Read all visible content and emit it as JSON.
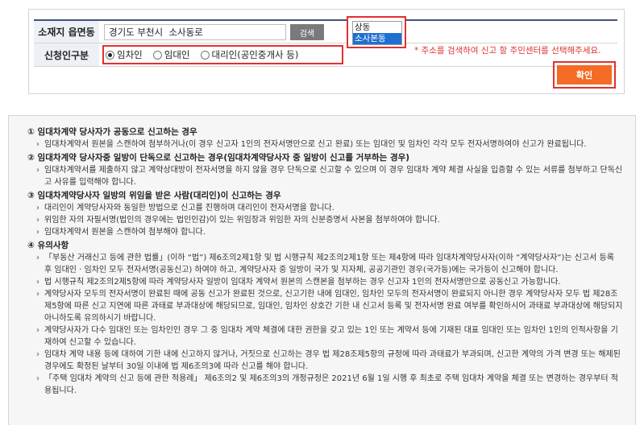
{
  "form": {
    "address_label": "소재지 읍면동",
    "address_value": "경기도 부천시  소사동로",
    "search_label": "검색",
    "dropdown_options": [
      "상동",
      "소사본동"
    ],
    "dropdown_selected_index": 1,
    "address_notice": "* 주소를 검색하여 신고 할 주민센터를 선택해주세요.",
    "applicant_label": "신청인구분",
    "applicant_options": [
      {
        "label": "임차인",
        "checked": true
      },
      {
        "label": "임대인",
        "checked": false
      },
      {
        "label": "대리인(공인중개사 등)",
        "checked": false
      }
    ],
    "confirm_label": "확인"
  },
  "info": {
    "sections": [
      {
        "heading": "① 임대차계약 당사자가 공동으로 신고하는 경우",
        "items": [
          "임대차계약서 원본을 스캔하여 첨부하거나(이 경우 신고자 1인의 전자서명만으로 신고 완료) 또는 임대인 및 임차인 각각 모두 전자서명하여야 신고가 완료됩니다."
        ]
      },
      {
        "heading": "② 임대차계약 당사자중 일방이 단독으로 신고하는 경우(임대차계약당사자 중 일방이 신고를 거부하는 경우)",
        "items": [
          "임대차계약서를 제출하지 않고 계약상대방이 전자서명을 하지 않을 경우 단독으로 신고할 수 있으며 이 경우 임대차 계약 체결 사실을 입증할 수 있는 서류를 첨부하고 단독신고 사유를 입력해야 합니다."
        ]
      },
      {
        "heading": "③ 임대차계약당사자 일방의 위임을 받은 사람(대리인)이 신고하는 경우",
        "items": [
          "대리인이 계약당사자와 동일한 방법으로 신고를 진행하며 대리인이 전자서명을 합니다.",
          "위임한 자의 자필서명(법인의 경우에는 법인인감)이 있는 위임장과 위임한 자의 신분증명서 사본을 첨부하여야 합니다.",
          "임대차계약서 원본을 스캔하여 첨부해야 합니다."
        ]
      },
      {
        "heading": "④ 유의사항",
        "items": [
          "「부동산 거래신고 등에 관한 법률」(이하 “법”) 제6조의2제1항 및 법 시행규칙 제2조의2제1항 또는 제4항에 따라 임대차계약당사자(이하 “계약당사자”)는 신고서 등록 후 임대인 · 임차인 모두 전자서명(공동신고) 하여야 하고, 계약당사자 중 일방이 국가 및 지자체, 공공기관인 경우(국가등)에는 국가등이 신고해야 합니다.",
          "법 시행규칙 제2조의2제5항에 따라 계약당사자 일방이 임대차 계약서 원본의 스캔본을 첨부하는 경우 신고자 1인의 전자서명만으로 공동신고 가능합니다.",
          "계약당사자 모두의 전자서명이 완료된 때에 공동 신고가 완료된 것으로, 신고기한 내에 임대인, 임차인 모두의 전자서명이 완료되지 아니한 경우 계약당사자 모두 법 제28조제5항에 따른 신고 지연에 따른 과태료 부과대상에 해당되므로, 임대인, 임차인 상호간 기한 내 신고서 등록 및 전자서명 완료 여부를 확인하시어 과태료 부과대상에 해당되지 아니하도록 유의하시기 바랍니다.",
          "계약당사자가 다수 임대인 또는 임차인인 경우 그 중 임대차 계약 체결에 대한 권한을 갖고 있는 1인 또는 계약서 등에 기재된 대표 임대인 또는 임차인 1인의 인적사항을 기재하여 신고할 수 있습니다.",
          "임대차 계약 내용 등에 대하여 기한 내에 신고하지 않거나, 거짓으로 신고하는 경우 법 제28조제5항의 규정에 따라 과태료가 부과되며, 신고한 계약의 가격 변경 또는 해제된 경우에도 확정된 날부터 30일 이내에 법 제6조의3에 따라 신고를 해야 합니다.",
          "「주택 임대차 계약의 신고 등에 관한 적용례」 제6조의2 및 제6조의3의 개정규정은 2021년 6월 1일 시행 후 최초로 주택 임대차 계약을 체결 또는 변경하는 경우부터 적용됩니다."
        ]
      }
    ]
  }
}
